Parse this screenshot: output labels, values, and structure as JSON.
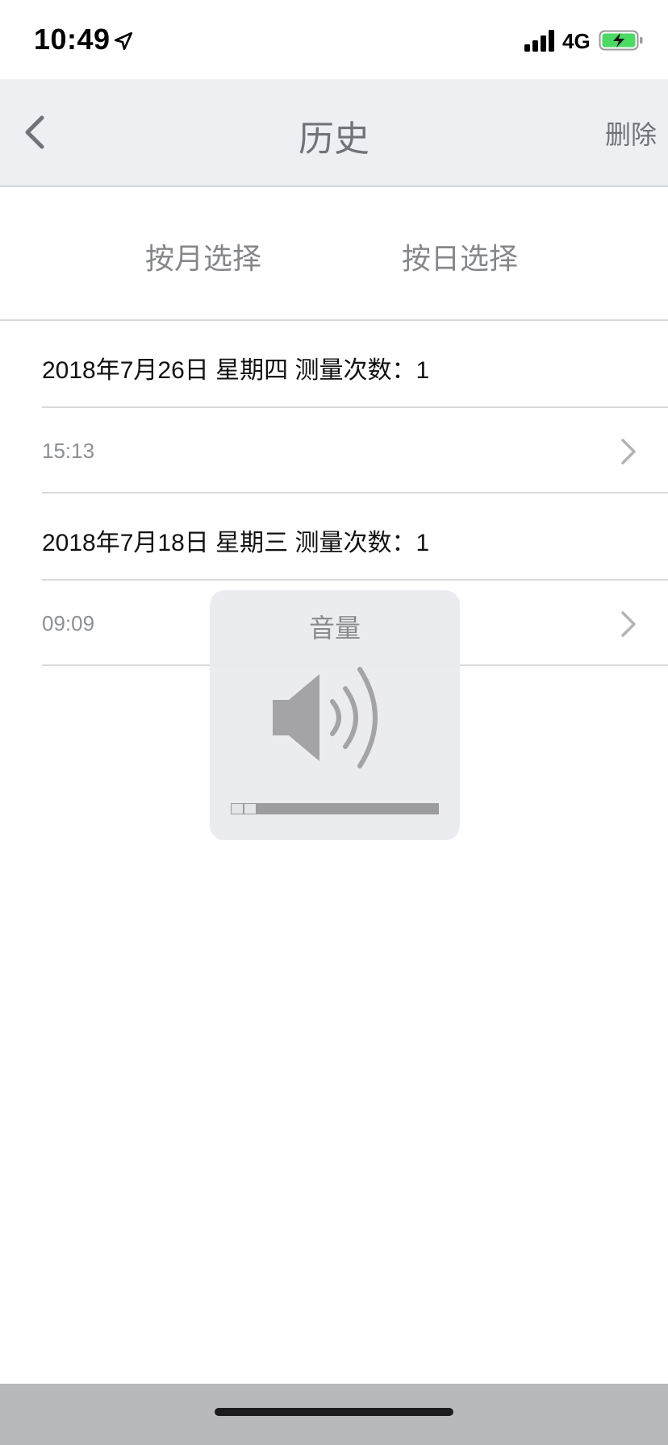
{
  "status_bar": {
    "time": "10:49",
    "network": "4G",
    "icons": [
      "location-arrow-icon",
      "signal-bars-icon",
      "battery-charging-icon"
    ],
    "battery_color": "#4cd964"
  },
  "nav": {
    "back_icon": "chevron-left-icon",
    "title": "历史",
    "action_label": "删除"
  },
  "filters": {
    "by_month": "按月选择",
    "by_day": "按日选择"
  },
  "history": [
    {
      "header": "2018年7月26日 星期四 测量次数：1",
      "records": [
        {
          "time": "15:13"
        }
      ]
    },
    {
      "header": "2018年7月18日 星期三 测量次数：1",
      "records": [
        {
          "time": "09:09"
        }
      ]
    }
  ],
  "volume_hud": {
    "title": "音量",
    "icon": "speaker-volume-icon",
    "level": 0.125
  },
  "colors": {
    "nav_background": "#edf0f3",
    "hud_background": "#eaebee",
    "home_area": "#b8b9bd"
  }
}
